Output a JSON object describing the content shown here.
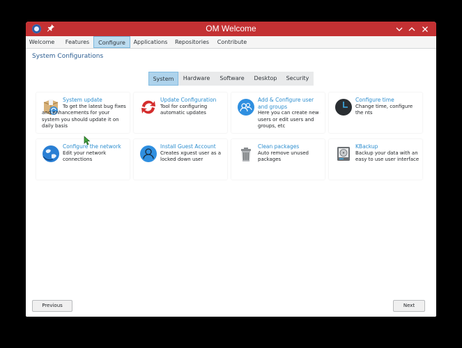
{
  "window": {
    "title": "OM Welcome",
    "titlebar_color": "#c33133"
  },
  "menu": {
    "items": [
      "Welcome",
      "Features",
      "Configure",
      "Applications",
      "Repositories",
      "Contribute"
    ],
    "active": "Configure"
  },
  "section": {
    "title": "System Configurations"
  },
  "subtabs": {
    "items": [
      "System",
      "Hardware",
      "Software",
      "Desktop",
      "Security"
    ],
    "active": "System"
  },
  "cards": [
    {
      "title": "System update",
      "desc": "To get the latest bug fixes and enhancements for your system you should update it on daily basis",
      "icon": "package-update-icon"
    },
    {
      "title": "Update Configuration",
      "desc": "Tool for configuring automatic updates",
      "icon": "update-config-icon"
    },
    {
      "title": "Add & Configure user and groups",
      "desc": "Here you can create new users or edit users and groups, etc",
      "icon": "users-icon"
    },
    {
      "title": "Configure time",
      "desc": "Change time, configure the nts",
      "icon": "clock-icon"
    },
    {
      "title": "Configure the network",
      "desc": "Edit your network connections",
      "icon": "network-globe-icon"
    },
    {
      "title": "Install Guest Account",
      "desc": "Creates xguest user as a locked down user",
      "icon": "guest-user-icon"
    },
    {
      "title": "Clean packages",
      "desc": "Auto remove unused packages",
      "icon": "trash-icon"
    },
    {
      "title": "KBackup",
      "desc": "Backup your data with an easy to use user interface",
      "icon": "backup-drive-icon"
    }
  ],
  "buttons": {
    "previous": "Previous",
    "next": "Next"
  },
  "accent": "#2d8ecf"
}
